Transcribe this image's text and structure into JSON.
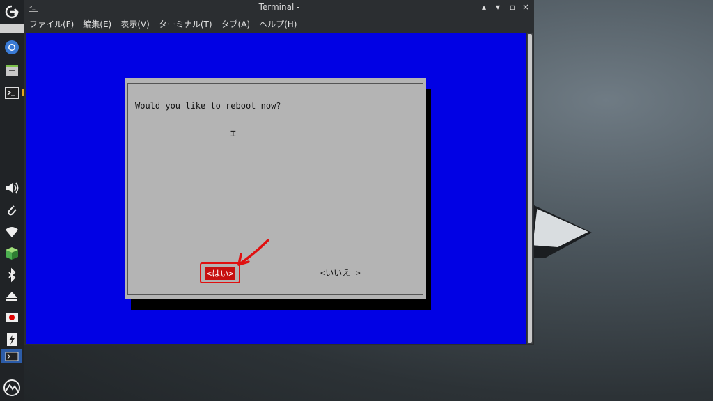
{
  "window": {
    "title": "Terminal -",
    "icon": "terminal-icon",
    "controls": [
      "▴",
      "▾",
      "▫",
      "×"
    ]
  },
  "menu": [
    "ファイル(F)",
    "編集(E)",
    "表示(V)",
    "ターミナル(T)",
    "タブ(A)",
    "ヘルプ(H)"
  ],
  "dialog": {
    "message": "Would you like to reboot now?",
    "yes": "<はい>",
    "no": "<いいえ >"
  },
  "taskbar": {
    "items": [
      "logout-icon",
      "chromium-icon",
      "file-manager-icon",
      "terminal-icon",
      "volume-icon",
      "paperclip-icon",
      "wifi-icon",
      "cube-icon",
      "bluetooth-icon",
      "eject-icon",
      "record-icon",
      "power-icon",
      "terminal-window-icon",
      "start-menu-icon"
    ]
  },
  "colors": {
    "terminal_bg": "#0101e4",
    "dialog_bg": "#b4b4b4",
    "yes_button": "#c71010",
    "annotation": "#e01010"
  }
}
